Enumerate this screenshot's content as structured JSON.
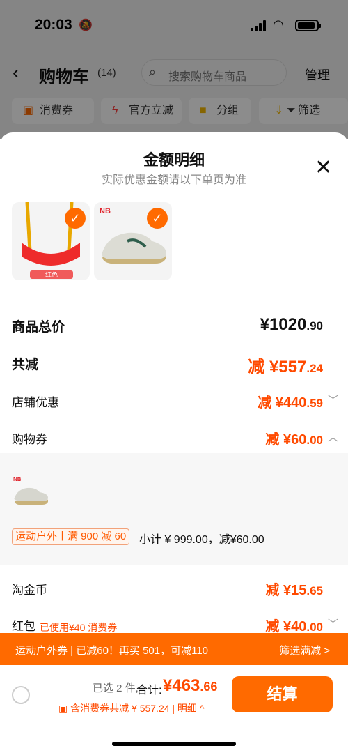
{
  "status": {
    "time": "20:03"
  },
  "nav": {
    "title": "购物车",
    "count": "(14)",
    "search_placeholder": "搜索购物车商品",
    "manage": "管理"
  },
  "chips": [
    {
      "label": "消费券",
      "icon": "coupon-icon"
    },
    {
      "label": "官方立减",
      "icon": "lightning-icon"
    },
    {
      "label": "分组",
      "icon": "folder-icon"
    },
    {
      "label": "筛选",
      "icon": "filter-icon"
    }
  ],
  "sheet": {
    "title": "金额明细",
    "subtitle": "实际优惠金额请以下单页为准",
    "items": [
      {
        "tag": "红色",
        "checked": true
      },
      {
        "checked": true
      }
    ],
    "rows": {
      "total": {
        "label": "商品总价",
        "int": "¥1020",
        "dec": ".90"
      },
      "discount": {
        "label": "共减",
        "int": "减 ¥557",
        "dec": ".24"
      },
      "store": {
        "label": "店铺优惠",
        "int": "减 ¥440",
        "dec": ".59"
      },
      "coupon": {
        "label": "购物券",
        "int": "减 ¥60",
        "dec": ".00"
      },
      "coin": {
        "label": "淘金币",
        "int": "减 ¥15",
        "dec": ".65"
      },
      "redpack": {
        "label": "红包",
        "note": "已使用¥40 消费券",
        "int": "减 ¥40",
        "dec": ".00"
      }
    },
    "coupon_detail": {
      "promo": "运动户外丨满 900 减 60",
      "subtotal": "小计 ¥ 999.00，减¥60.00"
    }
  },
  "banner": {
    "text": "运动户外券 | 已减60！再买 501，可减110",
    "right": "筛选满减 >"
  },
  "footer": {
    "selected": "已选 2 件,",
    "total_label": "合计:",
    "total_int": "¥463",
    "total_dec": ".66",
    "coupon_text": "含消费券共减 ¥ 557.24 | 明细 ^",
    "pay": "结算"
  },
  "colors": {
    "accent": "#ff6a00",
    "price": "#ff4a00"
  }
}
